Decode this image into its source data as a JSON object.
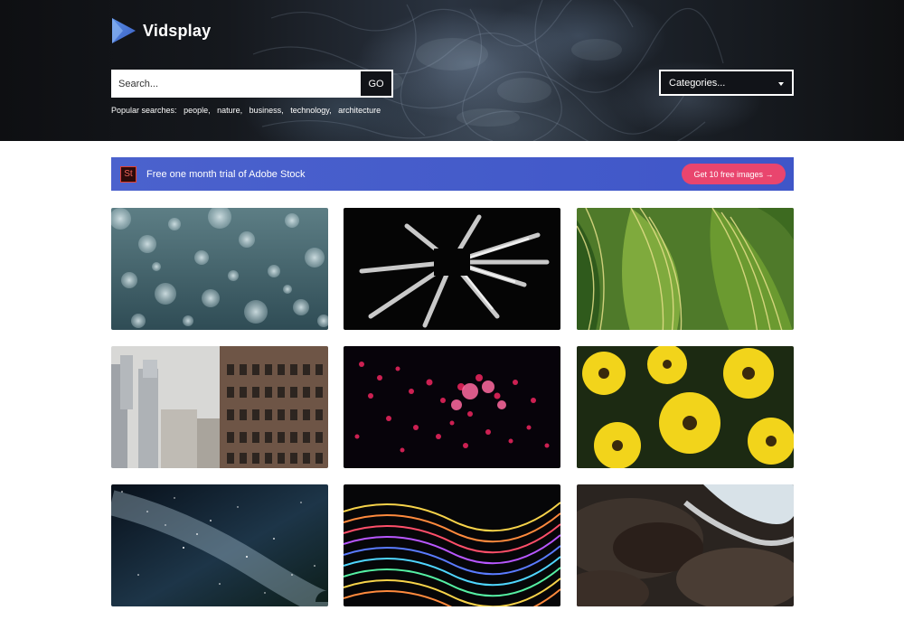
{
  "brand": {
    "name": "Vidsplay",
    "logo_icon": "play-triangle-logo-icon",
    "accent": "#4b7bd6"
  },
  "search": {
    "placeholder": "Search...",
    "go_label": "GO"
  },
  "popular": {
    "label": "Popular searches:",
    "terms": [
      "people,",
      "nature,",
      "business,",
      "technology,",
      "architecture"
    ]
  },
  "categories": {
    "label": "Categories...",
    "icon": "chevron-down-icon"
  },
  "banner": {
    "logo_text": "St",
    "text": "Free one month trial of Adobe Stock",
    "cta": "Get 10 free images →",
    "color": "#4b62cd",
    "cta_color": "#e9456e"
  },
  "videos": [
    {
      "subject": "bokeh-bubbles"
    },
    {
      "subject": "wrenches"
    },
    {
      "subject": "green-leaves"
    },
    {
      "subject": "city-buildings"
    },
    {
      "subject": "red-particles"
    },
    {
      "subject": "yellow-flowers"
    },
    {
      "subject": "milky-way"
    },
    {
      "subject": "colorful-lines"
    },
    {
      "subject": "water-rocks"
    }
  ]
}
